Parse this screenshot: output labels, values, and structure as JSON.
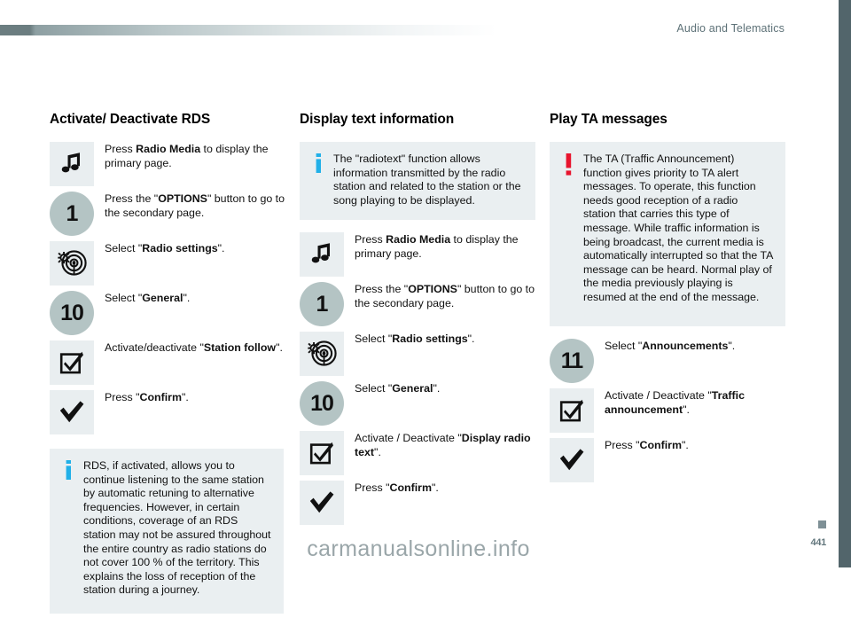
{
  "header": {
    "title": "Audio and Telematics"
  },
  "footer": {
    "watermark": "carmanualsonline.info",
    "page_number": "441"
  },
  "colors": {
    "accent_bar": "#6b7d80",
    "right_edge": "#52656b",
    "icon_box_bg": "#e9eef0",
    "icon_circle_bg": "#b4c4c4",
    "note_bg": "#eaeff1",
    "info_marker": "#21b0e8",
    "warning_marker": "#e8142d",
    "header_text": "#5d7177"
  },
  "columns": [
    {
      "id": "activate-deactivate-rds",
      "title": "Activate/ Deactivate RDS",
      "steps": [
        {
          "icon": "music-note-icon",
          "icon_style": "box",
          "text_parts": [
            {
              "t": "Press ",
              "b": false
            },
            {
              "t": "Radio Media",
              "b": true
            },
            {
              "t": " to display the primary page.",
              "b": false
            }
          ]
        },
        {
          "icon": "step-number-icon",
          "icon_style": "circle",
          "number": "1",
          "text_parts": [
            {
              "t": "Press the \"",
              "b": false
            },
            {
              "t": "OPTIONS",
              "b": true
            },
            {
              "t": "\" button to go to the secondary page.",
              "b": false
            }
          ]
        },
        {
          "icon": "radio-settings-icon",
          "icon_style": "box",
          "text_parts": [
            {
              "t": "Select \"",
              "b": false
            },
            {
              "t": "Radio settings",
              "b": true
            },
            {
              "t": "\".",
              "b": false
            }
          ]
        },
        {
          "icon": "step-number-icon",
          "icon_style": "circle",
          "number": "10",
          "text_parts": [
            {
              "t": "Select \"",
              "b": false
            },
            {
              "t": "General",
              "b": true
            },
            {
              "t": "\".",
              "b": false
            }
          ]
        },
        {
          "icon": "checkbox-checked-icon",
          "icon_style": "box",
          "text_parts": [
            {
              "t": "Activate/deactivate \"",
              "b": false
            },
            {
              "t": "Station follow",
              "b": true
            },
            {
              "t": "\".",
              "b": false
            }
          ]
        },
        {
          "icon": "checkmark-icon",
          "icon_style": "box",
          "text_parts": [
            {
              "t": "Press \"",
              "b": false
            },
            {
              "t": "Confirm",
              "b": true
            },
            {
              "t": "\".",
              "b": false
            }
          ]
        }
      ],
      "note": {
        "marker": "info",
        "text": "RDS, if activated, allows you to continue listening to the same station by automatic retuning to alternative frequencies. However, in certain conditions, coverage of an RDS station may not be assured throughout the entire country as radio stations do not cover 100 % of the territory. This explains the loss of reception of the station during a journey."
      }
    },
    {
      "id": "display-text-information",
      "title": "Display text information",
      "note": {
        "marker": "info",
        "text": "The \"radiotext\" function allows information transmitted by the radio station and related to the station or the song playing to be displayed."
      },
      "steps": [
        {
          "icon": "music-note-icon",
          "icon_style": "box",
          "text_parts": [
            {
              "t": "Press ",
              "b": false
            },
            {
              "t": "Radio Media",
              "b": true
            },
            {
              "t": " to display the primary page.",
              "b": false
            }
          ]
        },
        {
          "icon": "step-number-icon",
          "icon_style": "circle",
          "number": "1",
          "text_parts": [
            {
              "t": "Press the \"",
              "b": false
            },
            {
              "t": "OPTIONS",
              "b": true
            },
            {
              "t": "\" button to go to the secondary page.",
              "b": false
            }
          ]
        },
        {
          "icon": "radio-settings-icon",
          "icon_style": "box",
          "text_parts": [
            {
              "t": "Select \"",
              "b": false
            },
            {
              "t": "Radio settings",
              "b": true
            },
            {
              "t": "\".",
              "b": false
            }
          ]
        },
        {
          "icon": "step-number-icon",
          "icon_style": "circle",
          "number": "10",
          "text_parts": [
            {
              "t": "Select \"",
              "b": false
            },
            {
              "t": "General",
              "b": true
            },
            {
              "t": "\".",
              "b": false
            }
          ]
        },
        {
          "icon": "checkbox-checked-icon",
          "icon_style": "box",
          "text_parts": [
            {
              "t": "Activate / Deactivate \"",
              "b": false
            },
            {
              "t": "Display radio text",
              "b": true
            },
            {
              "t": "\".",
              "b": false
            }
          ]
        },
        {
          "icon": "checkmark-icon",
          "icon_style": "box",
          "text_parts": [
            {
              "t": "Press \"",
              "b": false
            },
            {
              "t": "Confirm",
              "b": true
            },
            {
              "t": "\".",
              "b": false
            }
          ]
        }
      ]
    },
    {
      "id": "play-ta-messages",
      "title": "Play TA messages",
      "note": {
        "marker": "warning",
        "text": "The TA (Traffic Announcement) function gives priority to TA alert messages. To operate, this function needs good reception of a radio station that carries this type of message. While traffic information is being broadcast, the current media is automatically interrupted so that the TA message can be heard. Normal play of the media previously playing is resumed at the end of the message."
      },
      "steps": [
        {
          "icon": "step-number-icon",
          "icon_style": "circle",
          "number": "11",
          "text_parts": [
            {
              "t": "Select \"",
              "b": false
            },
            {
              "t": "Announcements",
              "b": true
            },
            {
              "t": "\".",
              "b": false
            }
          ]
        },
        {
          "icon": "checkbox-checked-icon",
          "icon_style": "box",
          "text_parts": [
            {
              "t": "Activate / Deactivate \"",
              "b": false
            },
            {
              "t": "Traffic announcement",
              "b": true
            },
            {
              "t": "\".",
              "b": false
            }
          ]
        },
        {
          "icon": "checkmark-icon",
          "icon_style": "box",
          "text_parts": [
            {
              "t": "Press \"",
              "b": false
            },
            {
              "t": "Confirm",
              "b": true
            },
            {
              "t": "\".",
              "b": false
            }
          ]
        }
      ]
    }
  ]
}
